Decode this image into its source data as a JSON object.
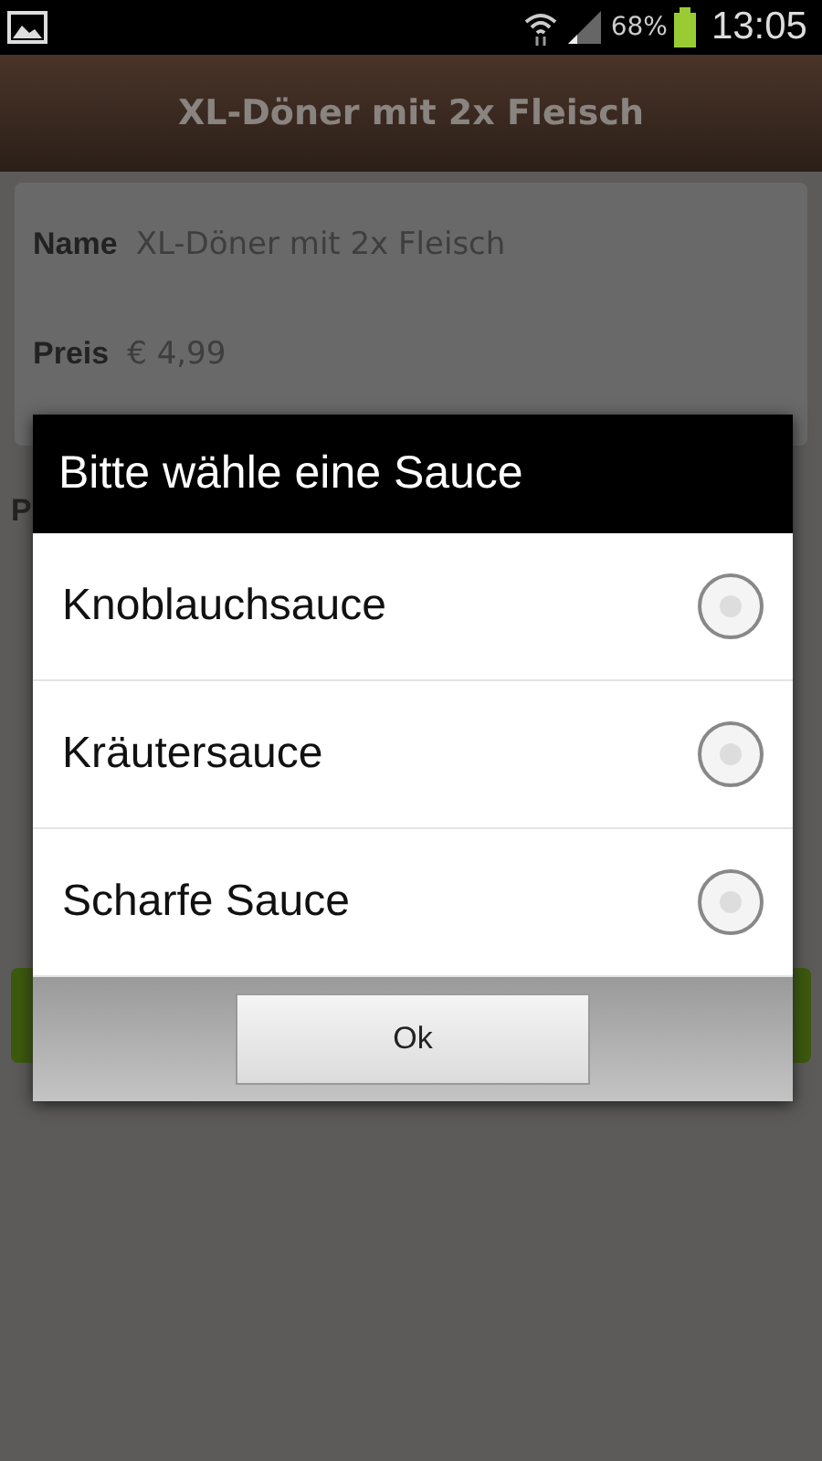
{
  "status_bar": {
    "battery": "68%",
    "time": "13:05"
  },
  "header": {
    "title": "XL-Döner mit 2x Fleisch"
  },
  "details": [
    {
      "label": "Name",
      "value": "XL-Döner mit 2x Fleisch"
    },
    {
      "label": "Preis",
      "value": "€ 4,99"
    }
  ],
  "hidden_label": "P",
  "dialog": {
    "title": "Bitte wähle eine Sauce",
    "options": [
      {
        "label": "Knoblauchsauce",
        "selected": false
      },
      {
        "label": "Kräutersauce",
        "selected": false
      },
      {
        "label": "Scharfe Sauce",
        "selected": false
      }
    ],
    "button": "Ok"
  }
}
